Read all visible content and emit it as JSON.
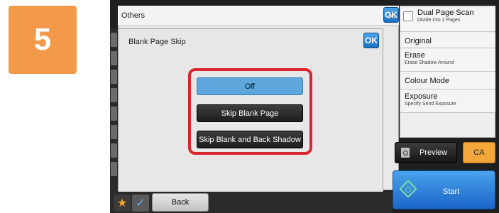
{
  "step_number": "5",
  "background_panel": {
    "title": "Others",
    "ok_label": "OK"
  },
  "dialog": {
    "title": "Blank Page Skip",
    "ok_label": "OK",
    "options": [
      {
        "label": "Off",
        "selected": true
      },
      {
        "label": "Skip Blank Page",
        "selected": false
      },
      {
        "label": "Skip Blank and Back Shadow",
        "selected": false
      }
    ]
  },
  "right_menu": {
    "items": [
      {
        "title": "Dual Page Scan",
        "subtitle": "Divide into 2 Pages"
      },
      {
        "title": "Original",
        "subtitle": ""
      },
      {
        "title": "Erase",
        "subtitle": "Erase Shadow Around"
      },
      {
        "title": "Colour Mode",
        "subtitle": ""
      },
      {
        "title": "Exposure",
        "subtitle": "Specify Send Exposure"
      }
    ]
  },
  "buttons": {
    "preview": "Preview",
    "ca": "CA",
    "start": "Start",
    "back": "Back"
  },
  "icons": {
    "star": "star-icon",
    "check": "checkmark-icon",
    "start": "start-diamond-icon",
    "preview": "preview-document-icon",
    "arrow": "play-arrow-icon"
  },
  "colors": {
    "highlight": "#d9262e",
    "selected_option": "#5da7dc",
    "start_button": "#1b66c9",
    "ca_button": "#f3a73a",
    "step_badge": "#f2994a"
  }
}
